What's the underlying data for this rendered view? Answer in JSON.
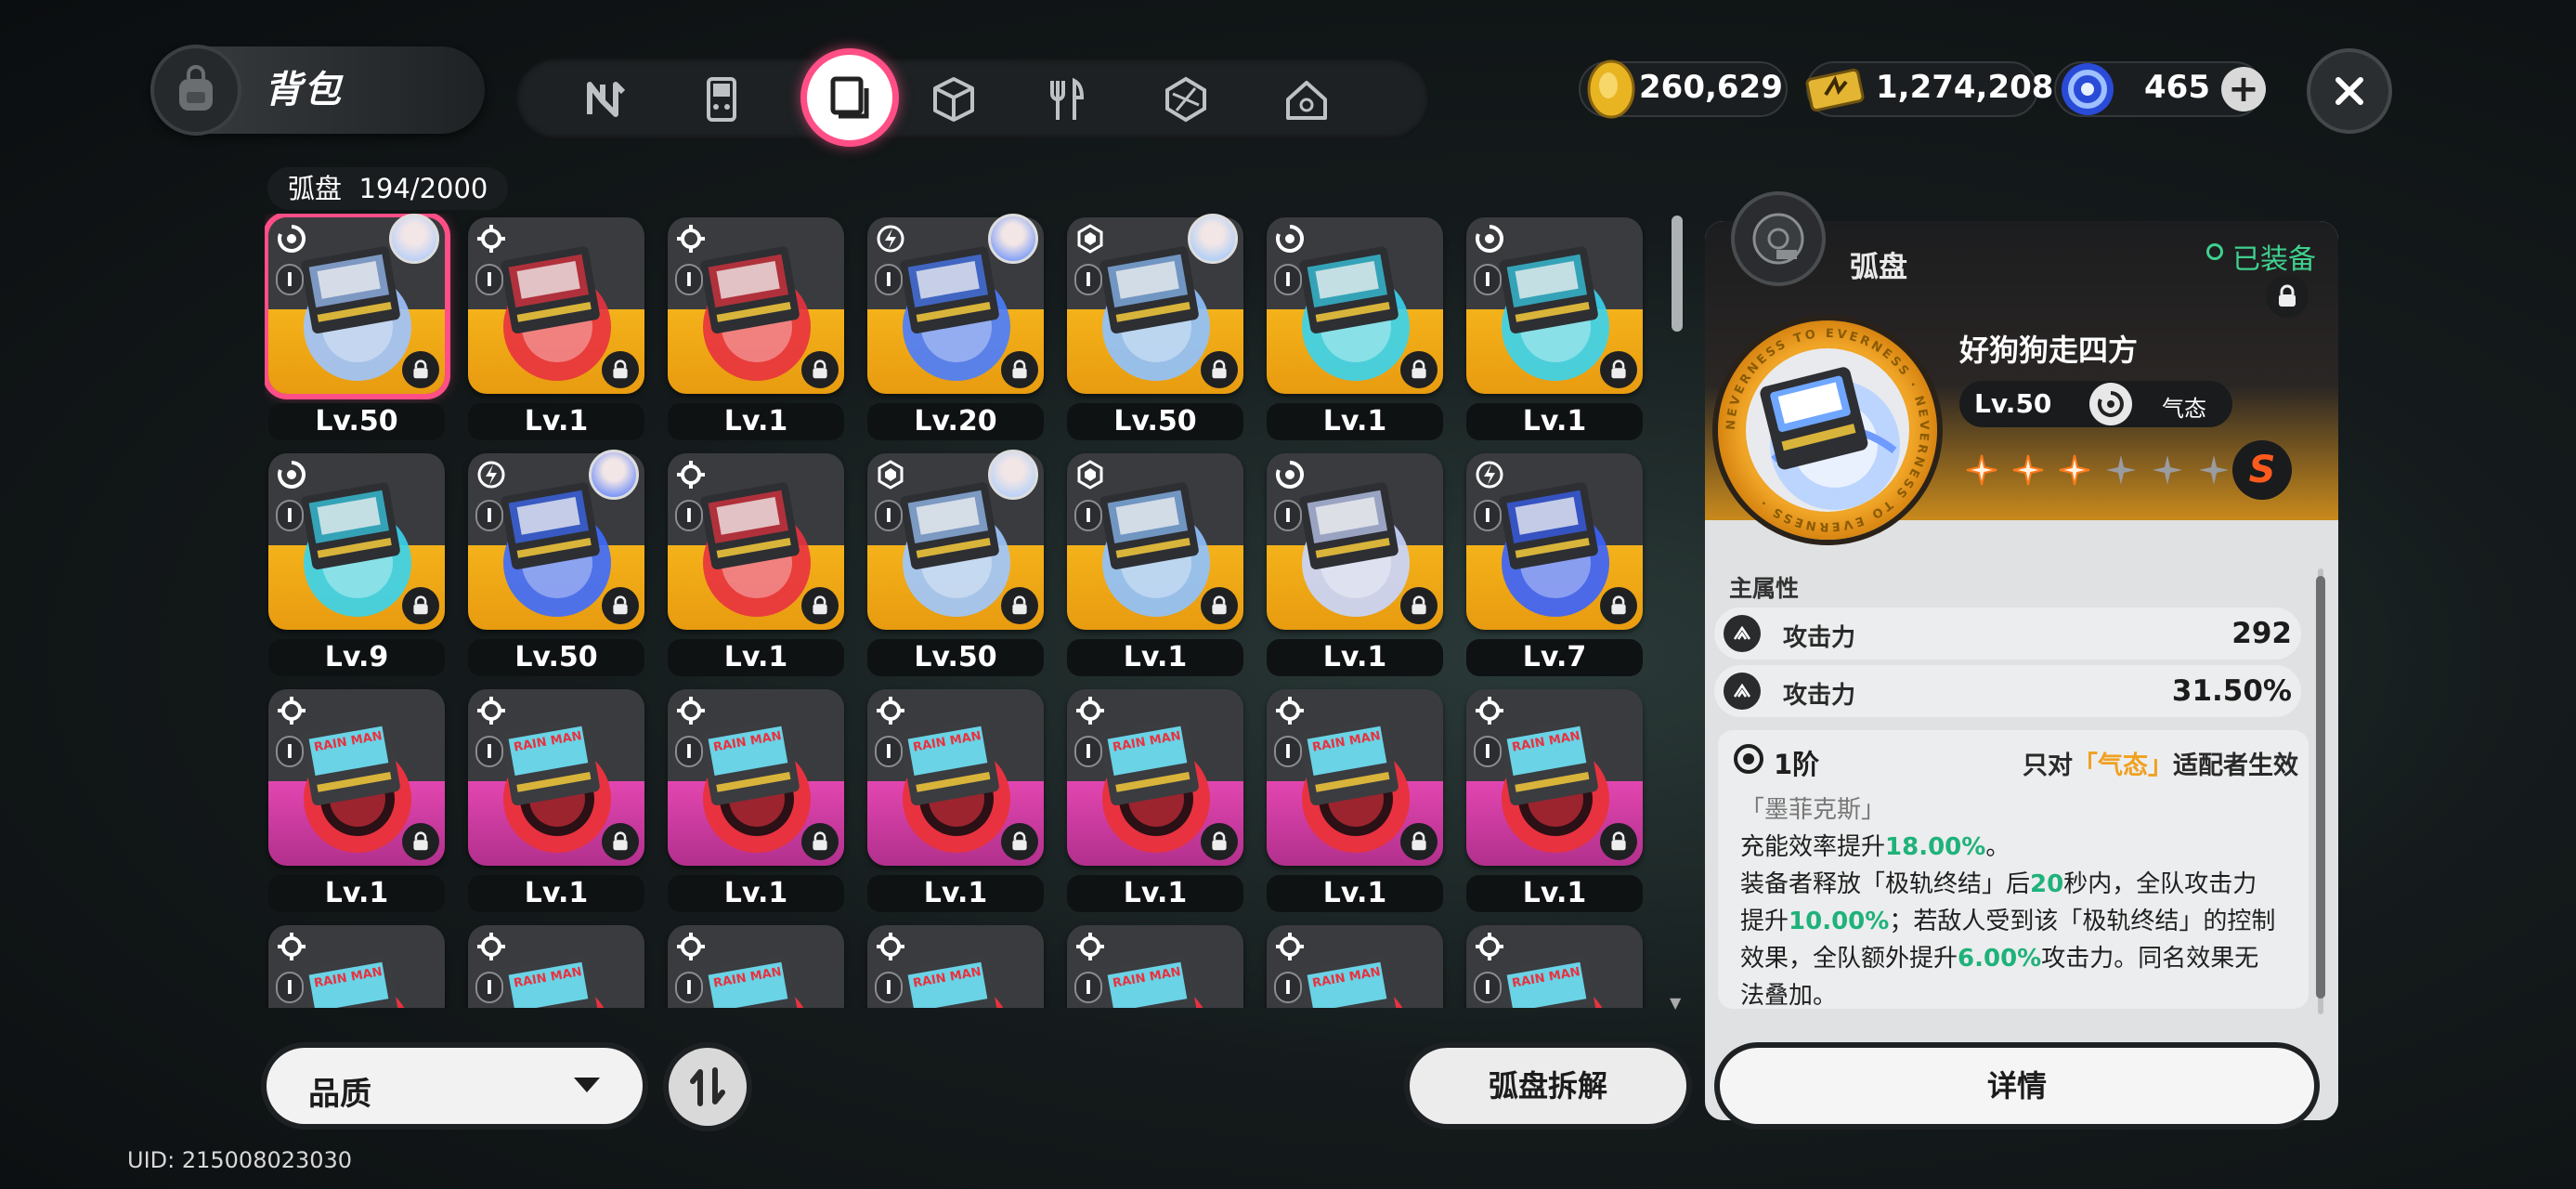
{
  "header": {
    "bag_title": "背包",
    "categories": [
      {
        "icon": "n-logo-icon",
        "active": false
      },
      {
        "icon": "handheld-console-icon",
        "active": false
      },
      {
        "icon": "disc-drive-icon",
        "active": true
      },
      {
        "icon": "cube-icon",
        "active": false
      },
      {
        "icon": "fork-knife-icon",
        "active": false
      },
      {
        "icon": "material-cube-icon",
        "active": false
      },
      {
        "icon": "home-icon",
        "active": false
      }
    ],
    "currencies": [
      {
        "icon": "gold-coin-icon",
        "value": "260,629"
      },
      {
        "icon": "ticket-icon",
        "value": "1,274,208"
      },
      {
        "icon": "polychrome-icon",
        "value": "465"
      }
    ],
    "plus_label": "+",
    "close_label": "✕"
  },
  "inventory": {
    "label": "弧盘",
    "count": "194/2000",
    "items": [
      {
        "level": "Lv.50",
        "rarity": "gold",
        "attr": "ether",
        "avatar": true,
        "color": "#9fc4ff",
        "selected": true
      },
      {
        "level": "Lv.1",
        "rarity": "gold",
        "attr": "physical",
        "avatar": false,
        "color": "#e8323f"
      },
      {
        "level": "Lv.1",
        "rarity": "gold",
        "attr": "physical",
        "avatar": false,
        "color": "#e8323f"
      },
      {
        "level": "Lv.20",
        "rarity": "gold",
        "attr": "electric",
        "avatar": true,
        "color": "#4a7dff"
      },
      {
        "level": "Lv.50",
        "rarity": "gold",
        "attr": "ice",
        "avatar": true,
        "color": "#8fc2ff"
      },
      {
        "level": "Lv.1",
        "rarity": "gold",
        "attr": "ether",
        "avatar": false,
        "color": "#39d4f0"
      },
      {
        "level": "Lv.1",
        "rarity": "gold",
        "attr": "ether",
        "avatar": false,
        "color": "#39d4f0"
      },
      {
        "level": "Lv.9",
        "rarity": "gold",
        "attr": "ether",
        "avatar": false,
        "color": "#39d4f0"
      },
      {
        "level": "Lv.50",
        "rarity": "gold",
        "attr": "electric",
        "avatar": true,
        "color": "#3d6cff"
      },
      {
        "level": "Lv.1",
        "rarity": "gold",
        "attr": "physical",
        "avatar": false,
        "color": "#e8323f"
      },
      {
        "level": "Lv.50",
        "rarity": "gold",
        "attr": "ice",
        "avatar": true,
        "color": "#9ec8ff"
      },
      {
        "level": "Lv.1",
        "rarity": "gold",
        "attr": "ice",
        "avatar": false,
        "color": "#8fc2ff"
      },
      {
        "level": "Lv.1",
        "rarity": "gold",
        "attr": "ether",
        "avatar": false,
        "color": "#c9d6ff"
      },
      {
        "level": "Lv.7",
        "rarity": "gold",
        "attr": "electric",
        "avatar": false,
        "color": "#3a63ff"
      },
      {
        "level": "Lv.1",
        "rarity": "pink",
        "attr": "physical",
        "avatar": false,
        "color": "#e8323f"
      },
      {
        "level": "Lv.1",
        "rarity": "pink",
        "attr": "physical",
        "avatar": false,
        "color": "#e8323f"
      },
      {
        "level": "Lv.1",
        "rarity": "pink",
        "attr": "physical",
        "avatar": false,
        "color": "#e8323f"
      },
      {
        "level": "Lv.1",
        "rarity": "pink",
        "attr": "physical",
        "avatar": false,
        "color": "#e8323f"
      },
      {
        "level": "Lv.1",
        "rarity": "pink",
        "attr": "physical",
        "avatar": false,
        "color": "#e8323f"
      },
      {
        "level": "Lv.1",
        "rarity": "pink",
        "attr": "physical",
        "avatar": false,
        "color": "#e8323f"
      },
      {
        "level": "Lv.1",
        "rarity": "pink",
        "attr": "physical",
        "avatar": false,
        "color": "#e8323f"
      },
      {
        "level": "",
        "rarity": "pink",
        "attr": "physical",
        "avatar": false,
        "color": "#e8323f"
      },
      {
        "level": "",
        "rarity": "pink",
        "attr": "physical",
        "avatar": false,
        "color": "#e8323f"
      },
      {
        "level": "",
        "rarity": "pink",
        "attr": "physical",
        "avatar": false,
        "color": "#e8323f"
      },
      {
        "level": "",
        "rarity": "pink",
        "attr": "physical",
        "avatar": false,
        "color": "#e8323f"
      },
      {
        "level": "",
        "rarity": "pink",
        "attr": "physical",
        "avatar": false,
        "color": "#e8323f"
      },
      {
        "level": "",
        "rarity": "pink",
        "attr": "physical",
        "avatar": false,
        "color": "#e8323f"
      },
      {
        "level": "",
        "rarity": "pink",
        "attr": "physical",
        "avatar": false,
        "color": "#e8323f"
      }
    ],
    "tier_badge": "I",
    "disc_label": "RAIN MAN"
  },
  "footer": {
    "quality_label": "品质",
    "dismantle_label": "弧盘拆解",
    "uid": "UID: 215008023030"
  },
  "detail": {
    "type_label": "弧盘",
    "equipped_label": "已装备",
    "name": "好狗狗走四方",
    "level": "Lv.50",
    "attribute_name": "气态",
    "stars_filled": 3,
    "stars_total": 6,
    "rank": "S",
    "ring_text": "NEVERNESS TO EVERNESS",
    "main_stats_label": "主属性",
    "stats": [
      {
        "name": "攻击力",
        "value": "292"
      },
      {
        "name": "攻击力",
        "value": "31.50%"
      }
    ],
    "effect": {
      "tier": "1阶",
      "only_prefix": "只对",
      "only_attr": "「气态」",
      "only_suffix": "适配者生效",
      "source": "「墨菲克斯」",
      "line1_a": "充能效率提升",
      "line1_b": "18.00%",
      "line1_c": "。",
      "line2_a": "装备者释放「极轨终结」后",
      "line2_b": "20",
      "line2_c": "秒内，全队攻击力",
      "line3_a": "提升",
      "line3_b": "10.00%",
      "line3_c": "；若敌人受到该「极轨终结」的控制",
      "line4_a": "效果，全队额外提升",
      "line4_b": "6.00%",
      "line4_c": "攻击力。同名效果无",
      "line5": "法叠加。"
    },
    "details_label": "详情"
  },
  "colors": {
    "accent_pink": "#ff4f86",
    "gold": "#f4b21a",
    "equipped_green": "#3fd18e",
    "highlight_green": "#1fb27a",
    "highlight_orange": "#f0a020"
  }
}
